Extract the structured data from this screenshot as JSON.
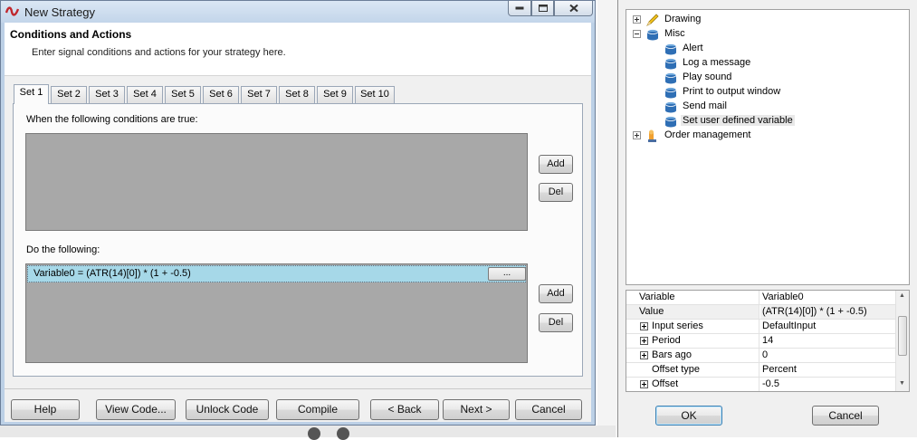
{
  "window": {
    "title": "New Strategy",
    "header_title": "Conditions and Actions",
    "header_subtitle": "Enter signal conditions and actions for your strategy here."
  },
  "tabs": [
    "Set 1",
    "Set 2",
    "Set 3",
    "Set 4",
    "Set 5",
    "Set 6",
    "Set 7",
    "Set 8",
    "Set 9",
    "Set 10"
  ],
  "active_tab": "Set 1",
  "conditions": {
    "label": "When the following conditions are true:",
    "add_label": "Add",
    "del_label": "Del"
  },
  "actions": {
    "label": "Do the following:",
    "items": [
      {
        "text": "Variable0 = (ATR(14)[0]) * (1 + -0.5)",
        "button": "..."
      }
    ],
    "add_label": "Add",
    "del_label": "Del"
  },
  "buttons": {
    "help": "Help",
    "view_code": "View Code...",
    "unlock_code": "Unlock Code",
    "compile": "Compile",
    "back": "< Back",
    "next": "Next >",
    "cancel": "Cancel"
  },
  "tree": {
    "nodes": [
      {
        "label": "Drawing",
        "icon": "pencil-icon",
        "expanded": false
      },
      {
        "label": "Misc",
        "icon": "misc-folder-icon",
        "expanded": true,
        "children": [
          "Alert",
          "Log a message",
          "Play sound",
          "Print to output window",
          "Send mail",
          "Set user defined variable"
        ]
      },
      {
        "label": "Order management",
        "icon": "order-management-icon",
        "expanded": false
      }
    ],
    "selected": "Set user defined variable"
  },
  "properties": [
    {
      "name": "Variable",
      "value": "Variable0",
      "expander": "none",
      "indent": false,
      "category": false
    },
    {
      "name": "Value",
      "value": "(ATR(14)[0]) * (1 + -0.5)",
      "expander": "minus",
      "indent": false,
      "category": true
    },
    {
      "name": "Input series",
      "value": "DefaultInput",
      "expander": "plus",
      "indent": true,
      "category": false
    },
    {
      "name": "Period",
      "value": "14",
      "expander": "plus",
      "indent": true,
      "category": false
    },
    {
      "name": "Bars ago",
      "value": "0",
      "expander": "plus",
      "indent": true,
      "category": false
    },
    {
      "name": "Offset type",
      "value": "Percent",
      "expander": "none",
      "indent": true,
      "category": false
    },
    {
      "name": "Offset",
      "value": "-0.5",
      "expander": "plus",
      "indent": true,
      "category": false
    }
  ],
  "dialog_buttons": {
    "ok": "OK",
    "cancel": "Cancel"
  }
}
